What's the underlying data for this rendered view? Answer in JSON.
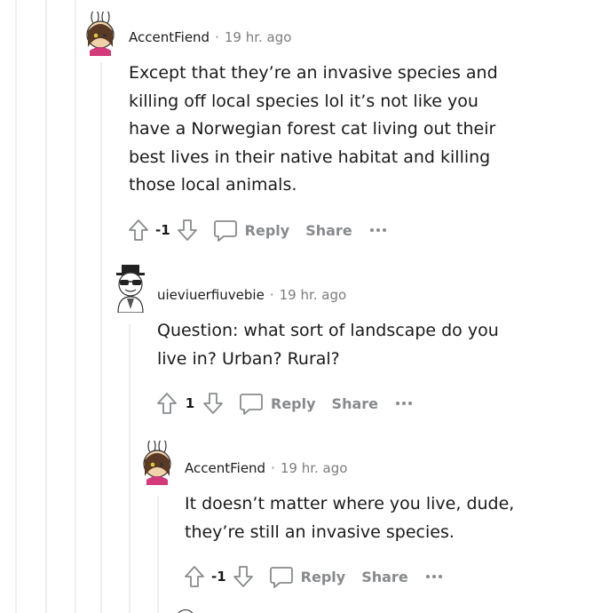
{
  "comments": [
    {
      "author": "AccentFiend",
      "separator": "·",
      "time": "19 hr. ago",
      "body": "Except that they’re an invasive species and killing off local species lol it’s not like you have a Norwegian forest cat living out their best lives in their native habitat and killing those local animals.",
      "score": "-1",
      "reply_label": "Reply",
      "share_label": "Share",
      "avatar_icon": "bunny-ear-avatar-icon"
    },
    {
      "author": "uieviuerfiuvebie",
      "separator": "·",
      "time": "19 hr. ago",
      "body": "Question: what sort of landscape do you live in? Urban? Rural?",
      "score": "1",
      "reply_label": "Reply",
      "share_label": "Share",
      "avatar_icon": "snoo-top-hat-avatar-icon"
    },
    {
      "author": "AccentFiend",
      "separator": "·",
      "time": "19 hr. ago",
      "body": "It doesn’t matter where you live, dude, they’re still an invasive species.",
      "score": "-1",
      "reply_label": "Reply",
      "share_label": "Share",
      "avatar_icon": "bunny-ear-avatar-icon"
    }
  ],
  "colors": {
    "thread_line": "#edeff1",
    "meta_gray": "#7c7c7c",
    "action_gray": "#878a8c"
  }
}
